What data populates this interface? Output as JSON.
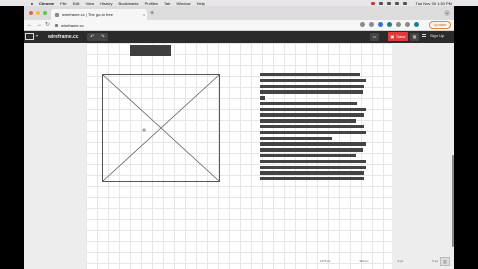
{
  "menubar": {
    "app": "Chrome",
    "items": [
      "File",
      "Edit",
      "View",
      "History",
      "Bookmarks",
      "Profiles",
      "Tab",
      "Window",
      "Help"
    ],
    "clock": "Tue Nov 30  1:30 PM"
  },
  "browser": {
    "tab_title": "wireframe.cc | The go-to free",
    "url": "wireframe.cc",
    "update_label": "Update"
  },
  "app": {
    "site_label": "wireframe.cc",
    "save_label": "Save",
    "signup_label": "Sign Up"
  },
  "status": {
    "items": [
      "1170 px",
      "993 px",
      "0 px",
      "0 px"
    ]
  },
  "colors": {
    "header_bg": "#2b2b2b",
    "save_red": "#e23a3a",
    "update_orange": "#d9882b"
  }
}
